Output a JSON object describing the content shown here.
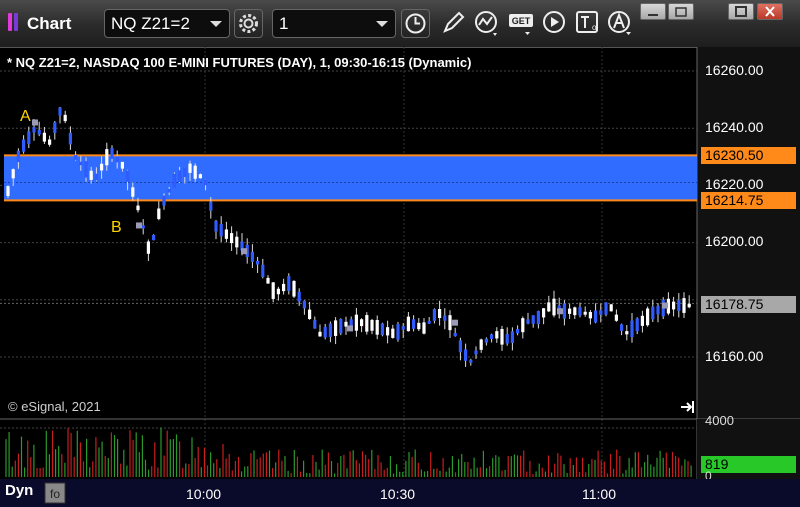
{
  "window": {
    "title": "Chart"
  },
  "toolbar": {
    "symbol": "NQ Z21=2",
    "interval": "1",
    "icons": [
      "gear-icon",
      "clock-icon",
      "pencil-icon",
      "study-icon",
      "get-icon",
      "play-icon",
      "text-icon",
      "alert-icon"
    ]
  },
  "chart": {
    "title": "* NQ Z21=2, NASDAQ 100 E-MINI FUTURES (DAY), 1, 09:30-16:15 (Dynamic)",
    "copyright": "© eSignal, 2021",
    "price_labels": [
      "16260.00",
      "16240.00",
      "16220.00",
      "16200.00",
      "16160.00"
    ],
    "upper_line_label": "16230.50",
    "lower_line_label": "16214.75",
    "last_price_label": "16178.75",
    "annotation_a": "A",
    "annotation_b": "B",
    "volume_labels": {
      "top": "4000",
      "last": "819",
      "zero": "0"
    },
    "time_labels": [
      "10:00",
      "10:30",
      "11:00"
    ],
    "bottom_label": "Dyn",
    "colors": {
      "band": "#2f6cff",
      "band_border": "#ff8a1a",
      "up_candle": "#ffffff",
      "down_candle": "#2f5bff",
      "vol_up": "#2a9a2a",
      "vol_down": "#c81e1e",
      "last_tag": "#a8a8a8",
      "vol_tag": "#29c829"
    }
  },
  "chart_data": {
    "type": "candlestick",
    "ylim": [
      16140,
      16268
    ],
    "bands": [
      {
        "upper": 16230.5,
        "lower": 16214.75
      }
    ],
    "last": 16178.75,
    "time_labels": [
      "10:00",
      "10:30",
      "11:00"
    ]
  }
}
